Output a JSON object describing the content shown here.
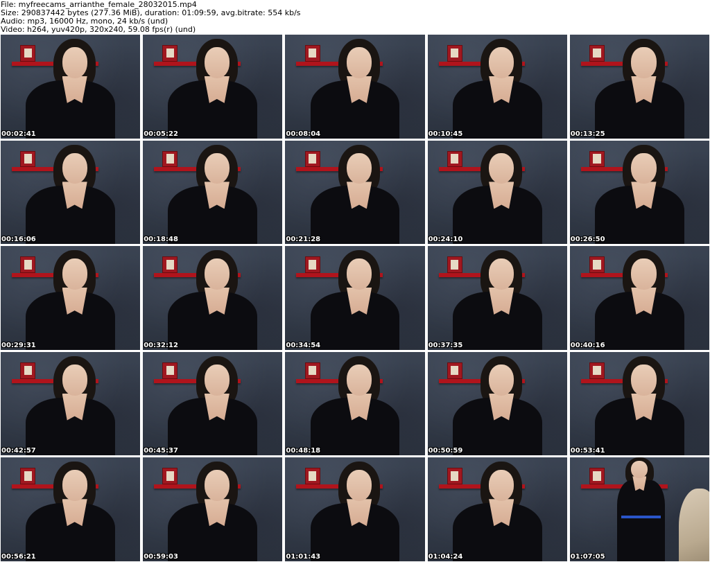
{
  "header": {
    "file_line": "File: myfreecams_arrianthe_female_28032015.mp4",
    "size_line": "Size: 290837442 bytes (277.36 MiB), duration: 01:09:59, avg.bitrate: 554 kb/s",
    "audio_line": "Audio: mp3, 16000 Hz, mono, 24 kb/s (und)",
    "video_line": "Video: h264, yuv420p, 320x240, 59.08 fps(r) (und)"
  },
  "thumbnails": [
    {
      "timestamp": "00:02:41"
    },
    {
      "timestamp": "00:05:22"
    },
    {
      "timestamp": "00:08:04"
    },
    {
      "timestamp": "00:10:45"
    },
    {
      "timestamp": "00:13:25"
    },
    {
      "timestamp": "00:16:06"
    },
    {
      "timestamp": "00:18:48"
    },
    {
      "timestamp": "00:21:28"
    },
    {
      "timestamp": "00:24:10"
    },
    {
      "timestamp": "00:26:50"
    },
    {
      "timestamp": "00:29:31"
    },
    {
      "timestamp": "00:32:12"
    },
    {
      "timestamp": "00:34:54"
    },
    {
      "timestamp": "00:37:35"
    },
    {
      "timestamp": "00:40:16"
    },
    {
      "timestamp": "00:42:57"
    },
    {
      "timestamp": "00:45:37"
    },
    {
      "timestamp": "00:48:18"
    },
    {
      "timestamp": "00:50:59"
    },
    {
      "timestamp": "00:53:41"
    },
    {
      "timestamp": "00:56:21"
    },
    {
      "timestamp": "00:59:03"
    },
    {
      "timestamp": "01:01:43"
    },
    {
      "timestamp": "01:04:24"
    },
    {
      "timestamp": "01:07:05",
      "standing": true
    }
  ]
}
